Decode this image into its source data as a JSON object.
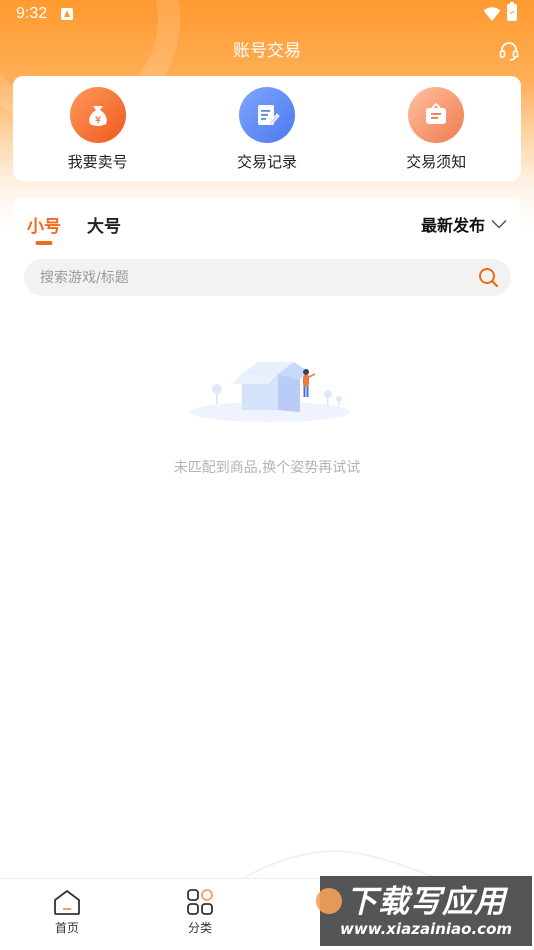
{
  "status_bar": {
    "time": "9:32"
  },
  "header": {
    "title": "账号交易",
    "service_icon": "headset-icon"
  },
  "quick_actions": [
    {
      "label": "我要卖号",
      "icon": "money-bag-icon",
      "color": "#f0581e"
    },
    {
      "label": "交易记录",
      "icon": "document-edit-icon",
      "color": "#4d78f0"
    },
    {
      "label": "交易须知",
      "icon": "notice-board-icon",
      "color": "#f07a4c"
    }
  ],
  "tabs": [
    {
      "label": "小号",
      "active": true
    },
    {
      "label": "大号",
      "active": false
    }
  ],
  "sort": {
    "label": "最新发布",
    "icon": "chevron-down-icon"
  },
  "search": {
    "placeholder": "搜索游戏/标题",
    "value": ""
  },
  "empty_state": {
    "message": "未匹配到商品,换个姿势再试试",
    "icon": "empty-box-icon"
  },
  "bottom_nav": [
    {
      "label": "首页",
      "icon": "home-icon"
    },
    {
      "label": "分类",
      "icon": "category-grid-icon"
    }
  ],
  "watermark": {
    "title": "下载写应用",
    "url": "www.xiazainiao.com"
  },
  "colors": {
    "accent": "#f06a1c",
    "header": "#ff9a2e"
  }
}
